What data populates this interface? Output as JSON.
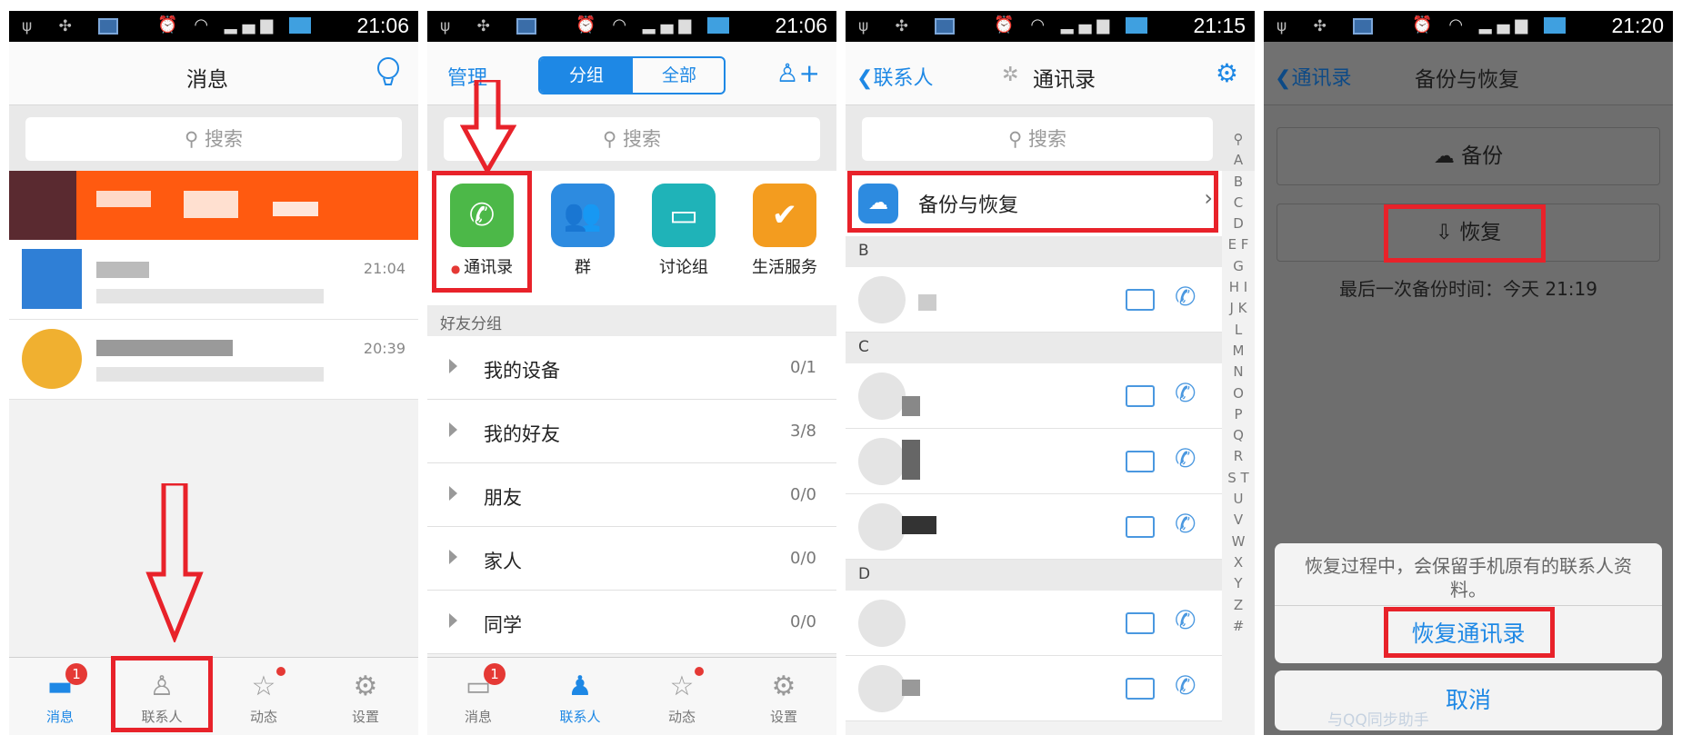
{
  "status": {
    "p1_time": "21:06",
    "p2_time": "21:06",
    "p3_time": "21:15",
    "p4_time": "21:20"
  },
  "panel1": {
    "title": "消息",
    "search": "搜索",
    "msg_times": [
      "21:04",
      "20:39"
    ],
    "tabs": [
      {
        "label": "消息",
        "icon": "chat-bubble-icon",
        "badge": "1"
      },
      {
        "label": "联系人",
        "icon": "person-icon"
      },
      {
        "label": "动态",
        "icon": "star-icon"
      },
      {
        "label": "设置",
        "icon": "gear-icon"
      }
    ]
  },
  "panel2": {
    "manage": "管理",
    "seg_group": "分组",
    "seg_all": "全部",
    "search": "搜索",
    "quick": [
      {
        "label": "通讯录",
        "icon": "phone-icon",
        "color": "#4cb848"
      },
      {
        "label": "群",
        "icon": "group-icon",
        "color": "#2d8be0"
      },
      {
        "label": "讨论组",
        "icon": "discussion-icon",
        "color": "#1fb3b8"
      },
      {
        "label": "生活服务",
        "icon": "service-badge-icon",
        "color": "#f39c1f"
      }
    ],
    "section": "好友分组",
    "groups": [
      {
        "name": "我的设备",
        "count": "0/1"
      },
      {
        "name": "我的好友",
        "count": "3/8"
      },
      {
        "name": "朋友",
        "count": "0/0"
      },
      {
        "name": "家人",
        "count": "0/0"
      },
      {
        "name": "同学",
        "count": "0/0"
      }
    ],
    "tabs": [
      {
        "label": "消息",
        "badge": "1"
      },
      {
        "label": "联系人"
      },
      {
        "label": "动态"
      },
      {
        "label": "设置"
      }
    ]
  },
  "panel3": {
    "back": "联系人",
    "title": "通讯录",
    "search": "搜索",
    "backup_row": "备份与恢复",
    "sections": [
      "B",
      "C",
      "D"
    ],
    "alphabet": "A B C D E F G H I J K L M N O P Q R S T U V W X Y Z #"
  },
  "panel4": {
    "back": "通讯录",
    "title": "备份与恢复",
    "backup_btn": "备份",
    "restore_btn": "恢复",
    "last_backup": "最后一次备份时间：今天 21:19",
    "sheet_msg": "恢复过程中，会保留手机原有的联系人资料。",
    "sheet_action": "恢复通讯录",
    "sheet_cancel": "取消",
    "footer_partial": "与QQ同步助手"
  },
  "colors": {
    "accent": "#1e88e5",
    "highlight": "#e8222a",
    "badge": "#e53935"
  }
}
